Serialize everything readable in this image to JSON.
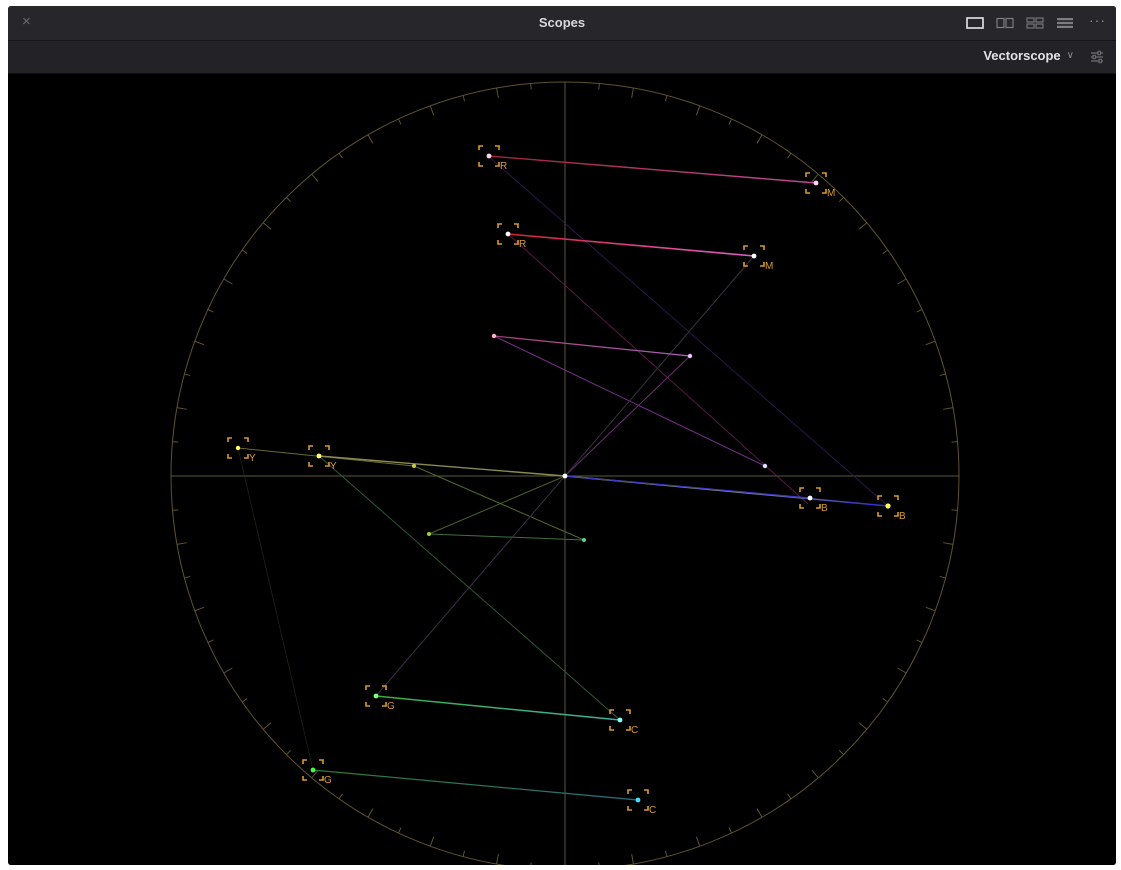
{
  "window": {
    "title": "Scopes",
    "close_icon": "close-icon"
  },
  "layout_buttons": [
    {
      "name": "single-layout-icon",
      "active": true
    },
    {
      "name": "dual-layout-icon",
      "active": false
    },
    {
      "name": "quad-layout-icon",
      "active": false
    },
    {
      "name": "list-layout-icon",
      "active": false
    }
  ],
  "more_label": "···",
  "toolbar": {
    "scope_type": "Vectorscope",
    "dropdown_icon": "chevron-down-icon",
    "settings_icon": "sliders-icon"
  },
  "colors": {
    "graticule": "#6b5a2e",
    "target": "#d79b2e",
    "crosshair": "#7a7444"
  },
  "targets": [
    {
      "label": "R"
    },
    {
      "label": "M"
    },
    {
      "label": "R"
    },
    {
      "label": "M"
    },
    {
      "label": "Y"
    },
    {
      "label": "Y"
    },
    {
      "label": "B"
    },
    {
      "label": "B"
    },
    {
      "label": "G"
    },
    {
      "label": "C"
    },
    {
      "label": "G"
    },
    {
      "label": "C"
    }
  ]
}
